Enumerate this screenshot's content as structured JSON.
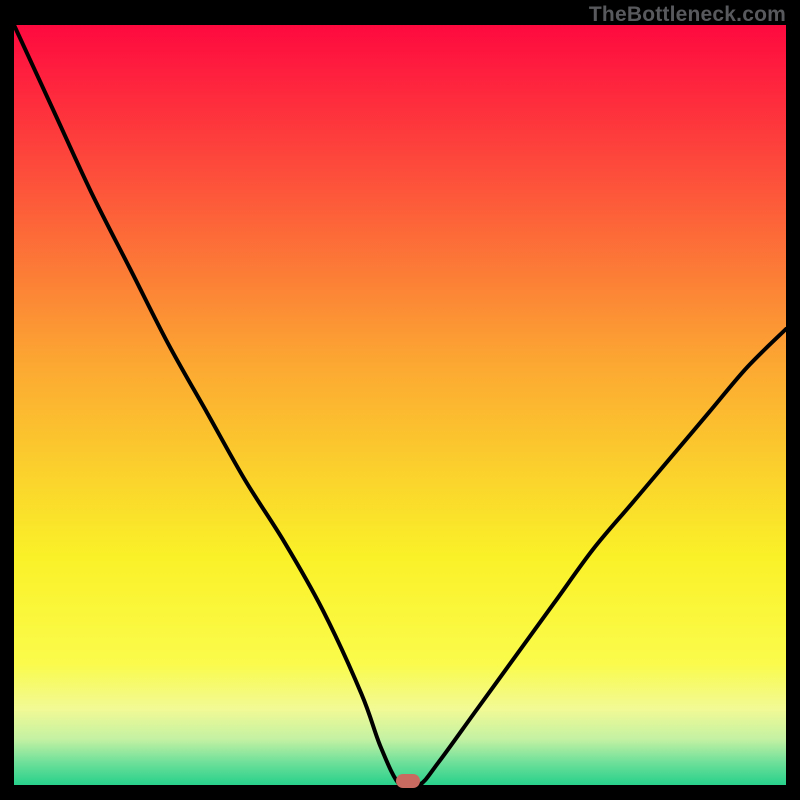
{
  "watermark": "TheBottleneck.com",
  "chart_data": {
    "type": "line",
    "x": [
      0.0,
      0.05,
      0.1,
      0.15,
      0.2,
      0.25,
      0.3,
      0.35,
      0.4,
      0.45,
      0.475,
      0.5,
      0.525,
      0.55,
      0.6,
      0.65,
      0.7,
      0.75,
      0.8,
      0.85,
      0.9,
      0.95,
      1.0
    ],
    "values": [
      100,
      89,
      78,
      68,
      58,
      49,
      40,
      32,
      23,
      12,
      5,
      0,
      0,
      3,
      10,
      17,
      24,
      31,
      37,
      43,
      49,
      55,
      60
    ],
    "title": "",
    "xlabel": "",
    "ylabel": "",
    "ylim": [
      0,
      100
    ],
    "marker": {
      "x": 0.51,
      "y": 0,
      "color": "#c96a60"
    },
    "gradient": [
      {
        "stop": 0,
        "color": "#fe093f"
      },
      {
        "stop": 20,
        "color": "#fd4f3b"
      },
      {
        "stop": 45,
        "color": "#fca932"
      },
      {
        "stop": 70,
        "color": "#faf128"
      },
      {
        "stop": 84,
        "color": "#fafb4b"
      },
      {
        "stop": 90,
        "color": "#f2fa95"
      },
      {
        "stop": 94,
        "color": "#c3f1a3"
      },
      {
        "stop": 97,
        "color": "#6fe09a"
      },
      {
        "stop": 100,
        "color": "#27d18b"
      }
    ]
  }
}
